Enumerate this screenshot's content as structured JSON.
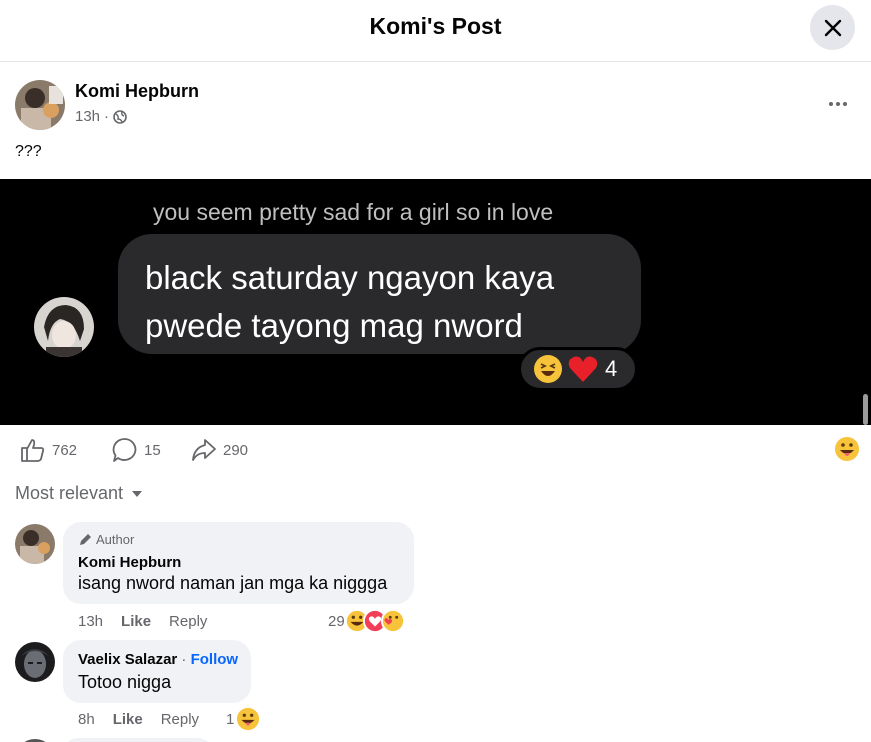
{
  "header": {
    "title": "Komi's Post"
  },
  "post": {
    "author": "Komi Hepburn",
    "time": "13h",
    "caption": "???"
  },
  "media": {
    "top_text": "you seem pretty sad for a girl so in love",
    "message_line1": "black saturday ngayon kaya",
    "message_line2": "pwede tayong mag nword",
    "reaction_count": "4"
  },
  "actions": {
    "likes": "762",
    "comments": "15",
    "shares": "290"
  },
  "sort": {
    "label": "Most relevant"
  },
  "comments": [
    {
      "badge": "Author",
      "name": "Komi Hepburn",
      "text": "isang nword naman jan mga ka niggga",
      "time": "13h",
      "like": "Like",
      "reply": "Reply",
      "reaction_count": "29"
    },
    {
      "name": "Vaelix Salazar",
      "separator": "·",
      "follow": "Follow",
      "text": "Totoo nigga",
      "time": "8h",
      "like": "Like",
      "reply": "Reply",
      "reaction_count": "1"
    }
  ]
}
